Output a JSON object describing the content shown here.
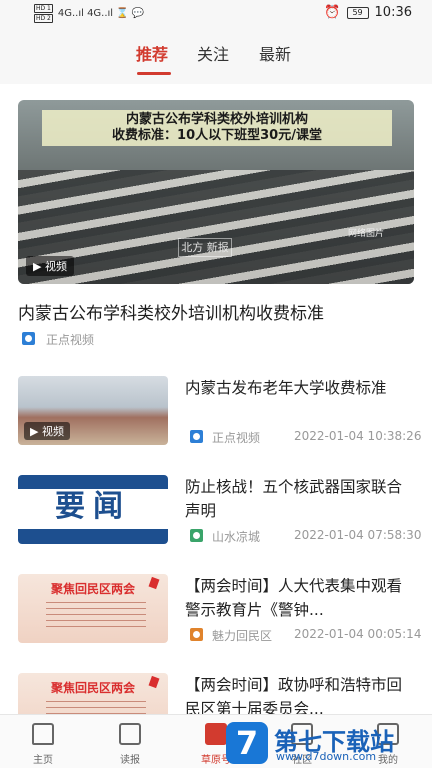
{
  "status_bar": {
    "sim1": "HD 1",
    "sim2": "HD 2",
    "signal": "4G..ıl 4G..ıl ⌛ 💬",
    "alarm_icon": "alarm-icon",
    "battery": "59",
    "time": "10:36"
  },
  "tabs": [
    {
      "label": "推荐",
      "active": true
    },
    {
      "label": "关注",
      "active": false
    },
    {
      "label": "最新",
      "active": false
    }
  ],
  "hero": {
    "caption_line1": "内蒙古公布学科类校外培训机构",
    "caption_line2": "收费标准：10人以下班型30元/课堂",
    "watermark": "北方 新报",
    "credit": "网络图片",
    "video_label": "▶ 视频",
    "title": "内蒙古公布学科类校外培训机构收费标准",
    "source": "正点视频"
  },
  "items": [
    {
      "title": "内蒙古发布老年大学收费标准",
      "source": "正点视频",
      "time": "2022-01-04 10:38:26",
      "video_label": "▶ 视频"
    },
    {
      "title": "防止核战！五个核武器国家联合声明",
      "source": "山水凉城",
      "time": "2022-01-04 07:58:30",
      "thumb_text": "要闻"
    },
    {
      "title": "【两会时间】人大代表集中观看警示教育片《警钟...",
      "source": "魅力回民区",
      "time": "2022-01-04 00:05:14",
      "thumb_text": "聚焦回民区两会"
    },
    {
      "title": "【两会时间】政协呼和浩特市回民区第十届委员会...",
      "thumb_text": "聚焦回民区两会"
    }
  ],
  "bottom_nav": [
    {
      "label": "主页",
      "icon": "home-icon"
    },
    {
      "label": "读报",
      "icon": "newspaper-icon"
    },
    {
      "label": "草原号",
      "icon": "grassland-icon",
      "active": true
    },
    {
      "label": "社区",
      "icon": "community-icon"
    },
    {
      "label": "我的",
      "icon": "profile-icon"
    }
  ],
  "site_logo": {
    "mark": "7",
    "text": "第七下载站",
    "url": "www.d7down.com"
  },
  "colors": {
    "accent": "#d23b2f",
    "source_blue": "#2d7fd6",
    "logo_blue": "#1977d6"
  }
}
